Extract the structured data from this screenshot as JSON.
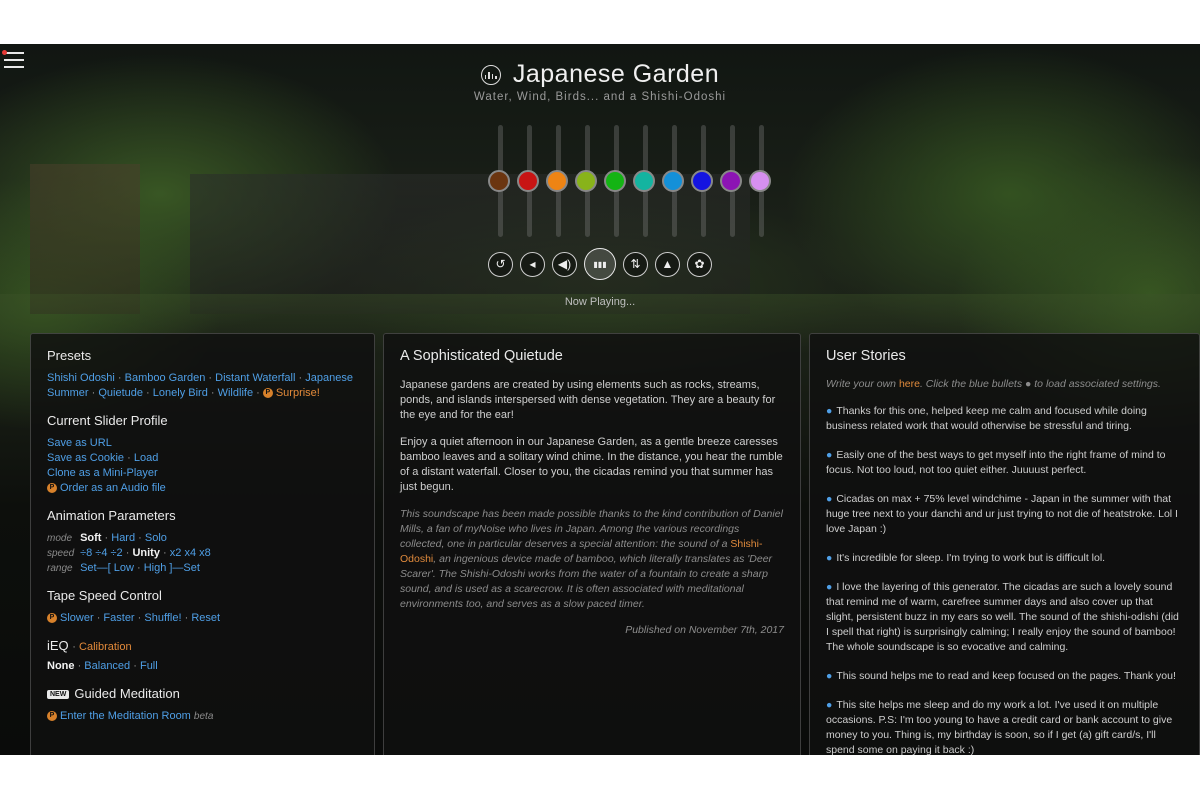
{
  "header": {
    "title": "Japanese Garden",
    "subtitle": "Water, Wind, Birds... and a Shishi-Odoshi"
  },
  "sliders": {
    "colors": [
      "#6b3510",
      "#c81414",
      "#ee8414",
      "#88b31a",
      "#14b414",
      "#14b4a0",
      "#1490d8",
      "#1414e0",
      "#8c14b4",
      "#d690f0"
    ],
    "levels": [
      0.5,
      0.5,
      0.5,
      0.5,
      0.5,
      0.5,
      0.5,
      0.5,
      0.5,
      0.5
    ]
  },
  "controls": {
    "icons": [
      "reset-icon",
      "volume-down-icon",
      "volume-up-icon",
      "equalizer-icon",
      "animate-icon",
      "bell-icon",
      "settings-icon"
    ],
    "glyphs": [
      "↺",
      "◂",
      "◀)",
      "▮▮▮",
      "⇅",
      "▲",
      "✿"
    ],
    "now_playing": "Now Playing..."
  },
  "left": {
    "presets_title": "Presets",
    "presets": [
      "Shishi Odoshi",
      "Bamboo Garden",
      "Distant Waterfall",
      "Japanese Summer",
      "Quietude",
      "Lonely Bird",
      "Wildlife",
      "Surprise!"
    ],
    "profile_title": "Current Slider Profile",
    "save_url": "Save as URL",
    "save_cookie": "Save as Cookie",
    "load": "Load",
    "clone_mini": "Clone as a Mini-Player",
    "order_audio": "Order as an Audio file",
    "anim_title": "Animation Parameters",
    "mode_label": "mode",
    "mode_soft": "Soft",
    "mode_hard": "Hard",
    "mode_solo": "Solo",
    "speed_label": "speed",
    "speed_x8_slow": "÷8",
    "speed_x4_slow": "÷4",
    "speed_x2_slow": "÷2",
    "speed_unity": "Unity",
    "speed_x2": "x2",
    "speed_x4": "x4",
    "speed_x8": "x8",
    "range_label": "range",
    "range_set_low_prefix": "Set—[",
    "range_low": "Low",
    "range_high": "High",
    "range_set_high_suffix": "]—Set",
    "tape_title": "Tape Speed Control",
    "tape_slower": "Slower",
    "tape_faster": "Faster",
    "tape_shuffle": "Shuffle!",
    "tape_reset": "Reset",
    "ieq_title": "iEQ",
    "ieq_calibration": "Calibration",
    "ieq_none": "None",
    "ieq_balanced": "Balanced",
    "ieq_full": "Full",
    "new_badge": "NEW",
    "guided_title": "Guided Meditation",
    "meditation_link": "Enter the Meditation Room",
    "meditation_beta": "beta",
    "p_badge": "P"
  },
  "middle": {
    "title": "A Sophisticated Quietude",
    "p1": "Japanese gardens are created by using elements such as rocks, streams, ponds, and islands interspersed with dense vegetation. They are a beauty for the eye and for the ear!",
    "p2": "Enjoy a quiet afternoon in our Japanese Garden, as a gentle breeze caresses bamboo leaves and a solitary wind chime. In the distance, you hear the rumble of a distant waterfall. Closer to you, the cicadas remind you that summer has just begun.",
    "credit_before": "This soundscape has been made possible thanks to the kind contribution of Daniel Mills, a fan of myNoise who lives in Japan. Among the various recordings collected, one in particular deserves a special attention: the sound of a ",
    "credit_highlight": "Shishi-Odoshi",
    "credit_after": ", an ingenious device made of bamboo, which literally translates as 'Deer Scarer'. The Shishi-Odoshi works from the water of a fountain to create a sharp sound, and is used as a scarecrow. It is often associated with meditational environments too, and serves as a slow paced timer.",
    "published": "Published on November 7th, 2017"
  },
  "right": {
    "title": "User Stories",
    "intro_before": "Write your own ",
    "intro_here": "here",
    "intro_after": ". Click the blue bullets ● to load associated settings.",
    "stories": [
      "Thanks for this one, helped keep me calm and focused while doing business related work that would otherwise be stressful and tiring.",
      "Easily one of the best ways to get myself into the right frame of mind to focus. Not too loud, not too quiet either. Juuuust perfect.",
      "Cicadas on max + 75% level windchime - Japan in the summer with that huge tree next to your danchi and ur just trying to not die of heatstroke. Lol I love Japan :)",
      "It's incredible for sleep. I'm trying to work but is difficult lol.",
      "I love the layering of this generator. The cicadas are such a lovely sound that remind me of warm, carefree summer days and also cover up that slight, persistent buzz in my ears so well. The sound of the shishi-odishi (did I spell that right) is surprisingly calming; I really enjoy the sound of bamboo! The whole soundscape is so evocative and calming.",
      "This sound helps me to read and keep focused on the pages. Thank you!",
      "This site helps me sleep and do my work a lot. I've used it on multiple occasions. P.S: I'm too young to have a credit card or bank account to give money to you. Thing is, my birthday is soon, so if I get (a) gift card/s, I'll spend some on paying it back :)"
    ]
  }
}
